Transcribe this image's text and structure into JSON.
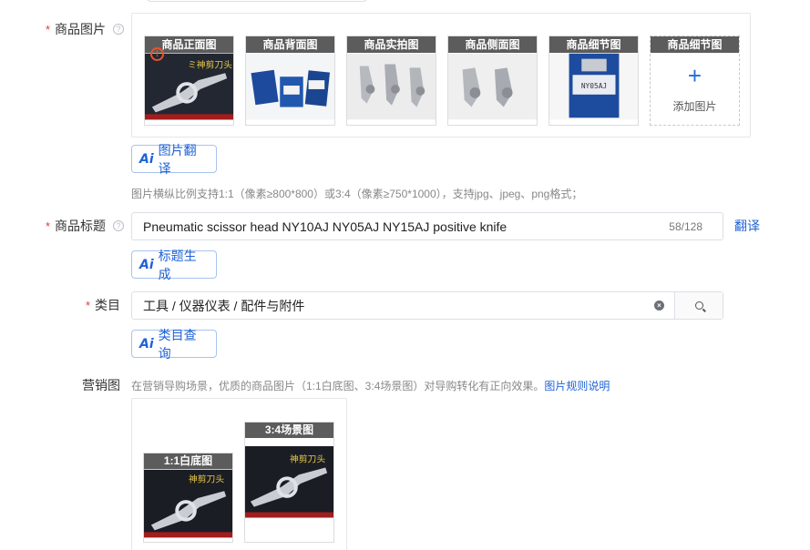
{
  "product_images": {
    "label": "商品图片",
    "slots": [
      {
        "title": "商品正面图"
      },
      {
        "title": "商品背面图"
      },
      {
        "title": "商品实拍图"
      },
      {
        "title": "商品侧面图"
      },
      {
        "title": "商品细节图"
      }
    ],
    "add_slot": {
      "title": "商品细节图",
      "plus": "+",
      "label": "添加图片"
    },
    "translate_button": "图片翻译",
    "hint": "图片横纵比例支持1:1（像素≥800*800）或3:4（像素≥750*1000），支持jpg、jpeg、png格式；"
  },
  "title_field": {
    "label": "商品标题",
    "value": "Pneumatic scissor head NY10AJ NY05AJ NY15AJ positive knife",
    "count": "58/128",
    "translate_link": "翻译",
    "generate_button": "标题生成"
  },
  "category_field": {
    "label": "类目",
    "value": "工具 / 仪器仪表 / 配件与附件",
    "query_button": "类目查询"
  },
  "marketing": {
    "label": "营销图",
    "hint": "在营销导购场景，优质的商品图片（1:1白底图、3:4场景图）对导购转化有正向效果。",
    "hint_link": "图片规则说明",
    "slots": [
      {
        "title": "1:1白底图"
      },
      {
        "title": "3:4场景图"
      }
    ]
  },
  "ai_badge": "Ai",
  "required_mark": "*",
  "help_mark": "?",
  "colors": {
    "accent": "#1f62d6",
    "required": "#e4393c"
  }
}
